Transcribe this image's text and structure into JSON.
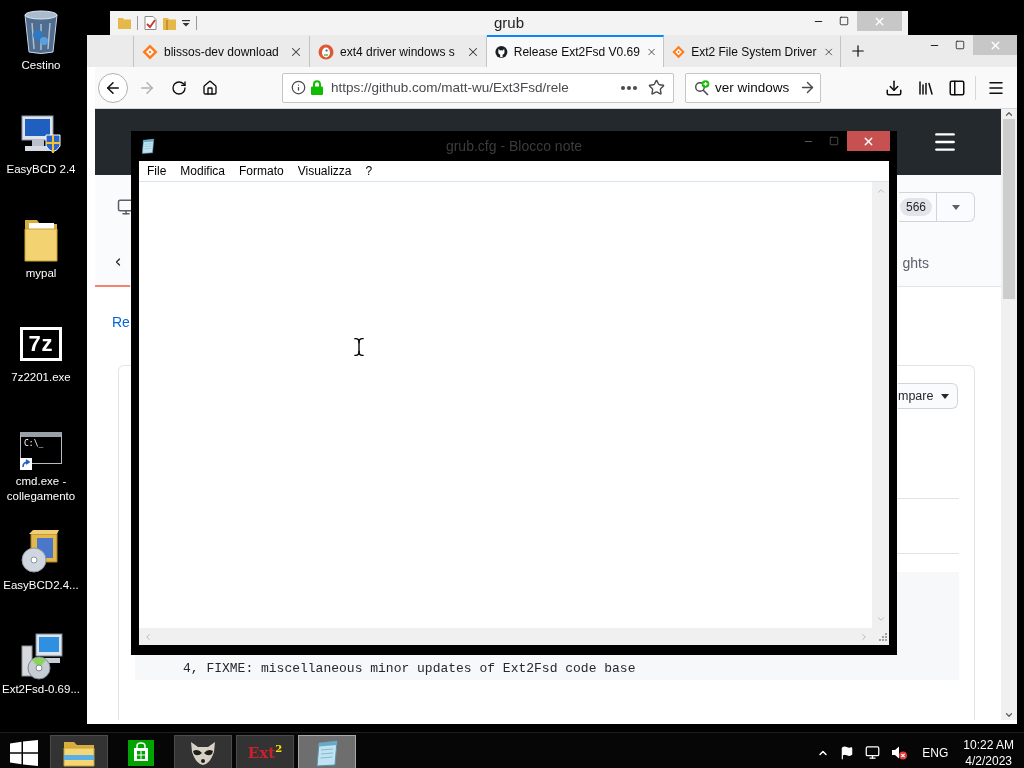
{
  "desktop_icons": [
    {
      "label": "Cestino",
      "kind": "trash"
    },
    {
      "label": "EasyBCD 2.4",
      "kind": "easybcd"
    },
    {
      "label": "mypal",
      "kind": "folder"
    },
    {
      "label": "7z2201.exe",
      "kind": "sevenzip",
      "logo": "7z"
    },
    {
      "label": "cmd.exe - collegamento",
      "kind": "console",
      "logo": "C:\\_"
    },
    {
      "label": "EasyBCD2.4...",
      "kind": "installer"
    },
    {
      "label": "Ext2Fsd-0.69...",
      "kind": "setup"
    }
  ],
  "explorer_window": {
    "title": "grub"
  },
  "browser": {
    "tabs": [
      {
        "title": "blissos-dev download",
        "kind": "diamond",
        "selected": false
      },
      {
        "title": "ext4 driver windows s",
        "kind": "duck",
        "selected": false
      },
      {
        "title": "Release Ext2Fsd V0.69",
        "kind": "cat",
        "selected": true
      },
      {
        "title": "Ext2 File System Driver",
        "kind": "diamond",
        "selected": false
      }
    ],
    "forward_disabled": true,
    "url": "https://github.com/matt-wu/Ext3Fsd/rele",
    "search": {
      "value": "ver windows"
    },
    "page": {
      "counter": "566",
      "tab_label": "ghts",
      "link": "Re",
      "button_label": "mpare",
      "code_line": "4, FIXME: miscellaneous minor updates of Ext2Fsd code base"
    }
  },
  "notepad": {
    "title": "grub.cfg - Blocco note",
    "menu": [
      "File",
      "Modifica",
      "Formato",
      "Visualizza",
      "?"
    ]
  },
  "taskbar": {
    "apps": [
      {
        "kind": "explorer",
        "running": true,
        "selected": false
      },
      {
        "kind": "store",
        "running": false,
        "selected": false
      },
      {
        "kind": "raccoon",
        "running": true,
        "selected": false
      },
      {
        "kind": "ext2",
        "logo": "Ext$^{2}$",
        "running": true,
        "selected": false
      },
      {
        "kind": "notepad",
        "running": true,
        "selected": true
      }
    ],
    "language": "ENG",
    "time": "10:22 AM",
    "date": "4/2/2023"
  }
}
